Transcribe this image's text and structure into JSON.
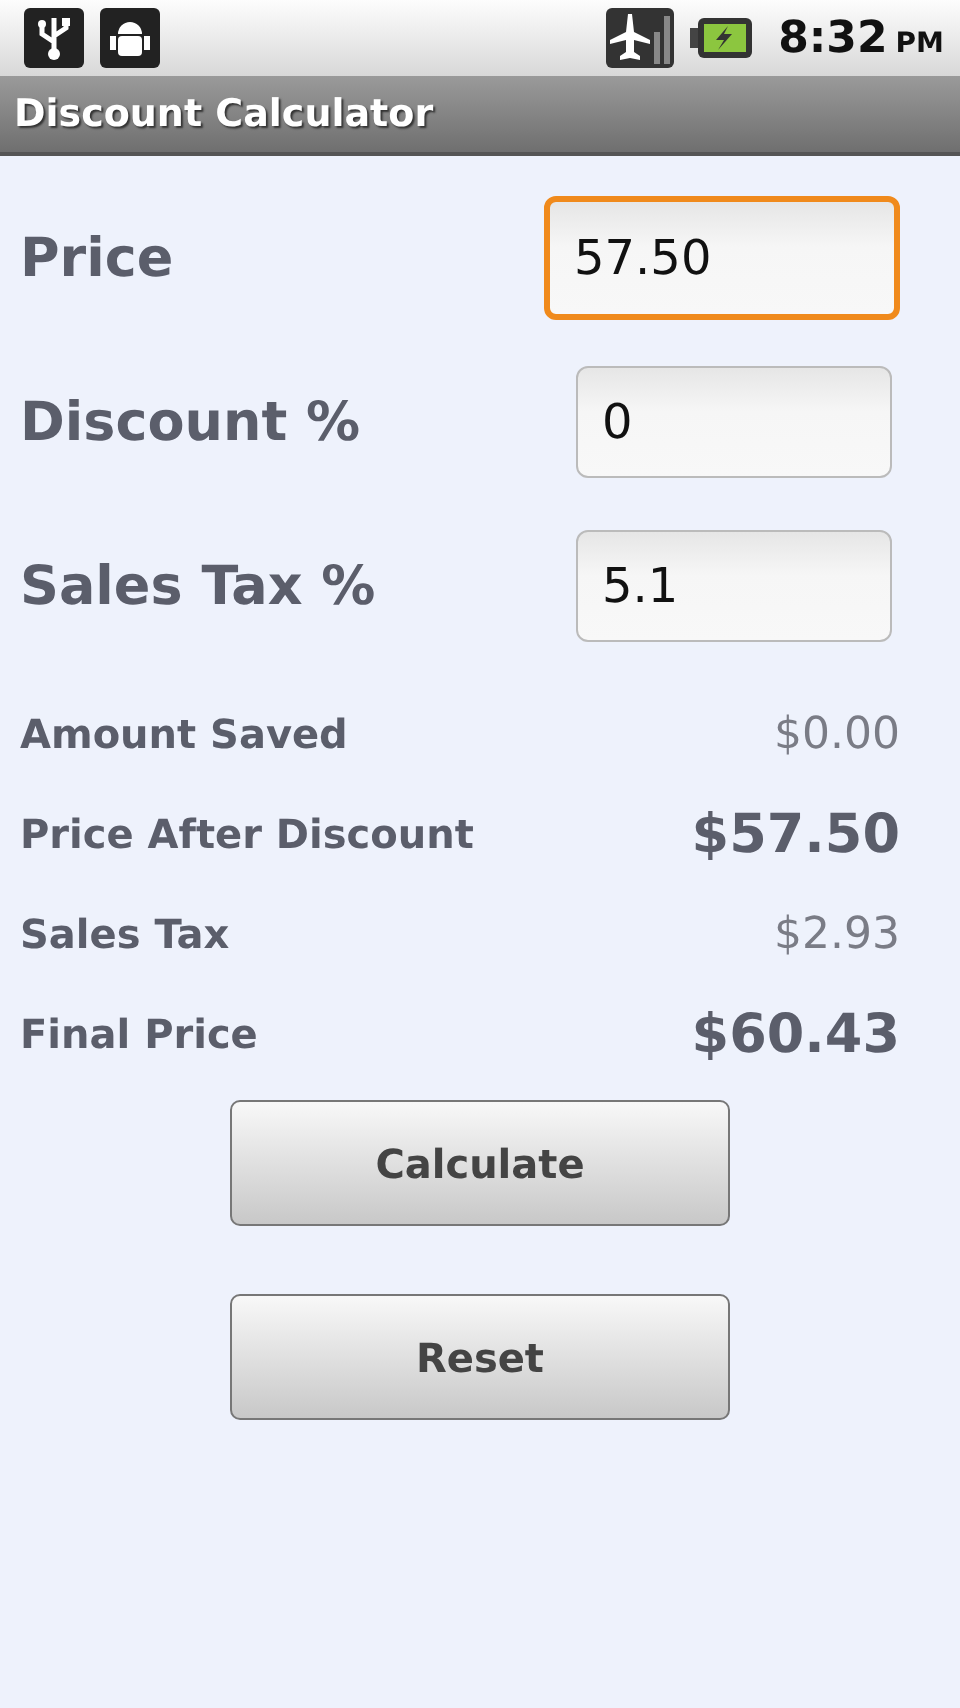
{
  "status_bar": {
    "time": "8:32",
    "ampm": "PM"
  },
  "window": {
    "title": "Discount Calculator"
  },
  "inputs": [
    {
      "label": "Price",
      "value": "57.50",
      "focused": true
    },
    {
      "label": "Discount %",
      "value": "0",
      "focused": false
    },
    {
      "label": "Sales Tax %",
      "value": "5.1",
      "focused": false
    }
  ],
  "results": [
    {
      "label": "Amount Saved",
      "value": "$0.00",
      "emphasis": false
    },
    {
      "label": "Price After Discount",
      "value": "$57.50",
      "emphasis": true
    },
    {
      "label": "Sales Tax",
      "value": "$2.93",
      "emphasis": false
    },
    {
      "label": "Final Price",
      "value": "$60.43",
      "emphasis": true
    }
  ],
  "buttons": [
    "Calculate",
    "Reset"
  ]
}
